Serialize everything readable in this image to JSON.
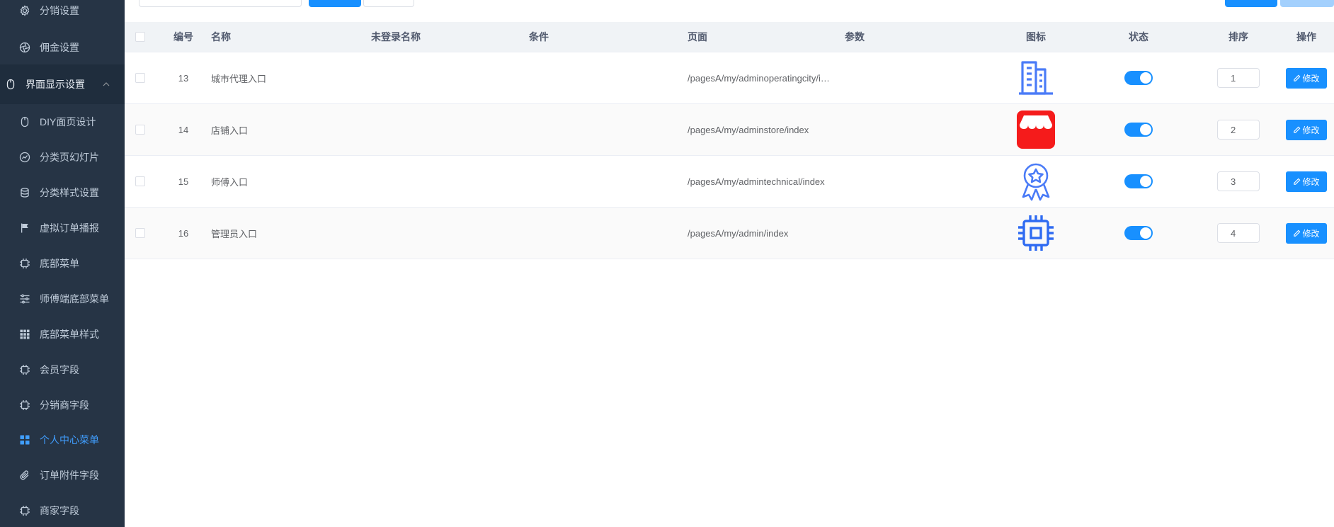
{
  "sidebar": {
    "items": [
      {
        "label": "分销设置",
        "icon": "gear-icon"
      },
      {
        "label": "佣金设置",
        "icon": "aperture-icon"
      },
      {
        "label": "界面显示设置",
        "icon": "mouse-icon",
        "expanded": true
      },
      {
        "label": "DIY面页设计",
        "icon": "mouse-icon"
      },
      {
        "label": "分类页幻灯片",
        "icon": "speed-icon"
      },
      {
        "label": "分类样式设置",
        "icon": "stack-icon"
      },
      {
        "label": "虚拟订单播报",
        "icon": "flag-icon"
      },
      {
        "label": "底部菜单",
        "icon": "chip-icon"
      },
      {
        "label": "师傅端底部菜单",
        "icon": "sliders-icon"
      },
      {
        "label": "底部菜单样式",
        "icon": "grid-icon"
      },
      {
        "label": "会员字段",
        "icon": "chip-icon"
      },
      {
        "label": "分销商字段",
        "icon": "chip-icon"
      },
      {
        "label": "个人中心菜单",
        "icon": "apps-icon",
        "active": true
      },
      {
        "label": "订单附件字段",
        "icon": "paperclip-icon"
      },
      {
        "label": "商家字段",
        "icon": "chip-icon"
      }
    ]
  },
  "table": {
    "headers": {
      "id": "编号",
      "name": "名称",
      "unlogged_name": "未登录名称",
      "condition": "条件",
      "page": "页面",
      "params": "参数",
      "icon": "图标",
      "status": "状态",
      "sort": "排序",
      "action": "操作"
    },
    "rows": [
      {
        "id": "13",
        "name": "城市代理入口",
        "unlogged_name": "",
        "condition": "",
        "page": "/pagesA/my/adminoperatingcity/i…",
        "params": "",
        "icon": "building-icon",
        "status": true,
        "sort": "1",
        "action": "修改"
      },
      {
        "id": "14",
        "name": "店铺入口",
        "unlogged_name": "",
        "condition": "",
        "page": "/pagesA/my/adminstore/index",
        "params": "",
        "icon": "store-icon",
        "status": true,
        "sort": "2",
        "action": "修改"
      },
      {
        "id": "15",
        "name": "师傅入口",
        "unlogged_name": "",
        "condition": "",
        "page": "/pagesA/my/admintechnical/index",
        "params": "",
        "icon": "award-icon",
        "status": true,
        "sort": "3",
        "action": "修改"
      },
      {
        "id": "16",
        "name": "管理员入口",
        "unlogged_name": "",
        "condition": "",
        "page": "/pagesA/my/admin/index",
        "params": "",
        "icon": "chip-icon",
        "status": true,
        "sort": "4",
        "action": "修改"
      }
    ]
  },
  "colors": {
    "sidebar_bg": "#263445",
    "primary": "#1890ff",
    "active_text": "#409eff",
    "store_red": "#f51b1b",
    "icon_blue": "#4a7bf7"
  }
}
